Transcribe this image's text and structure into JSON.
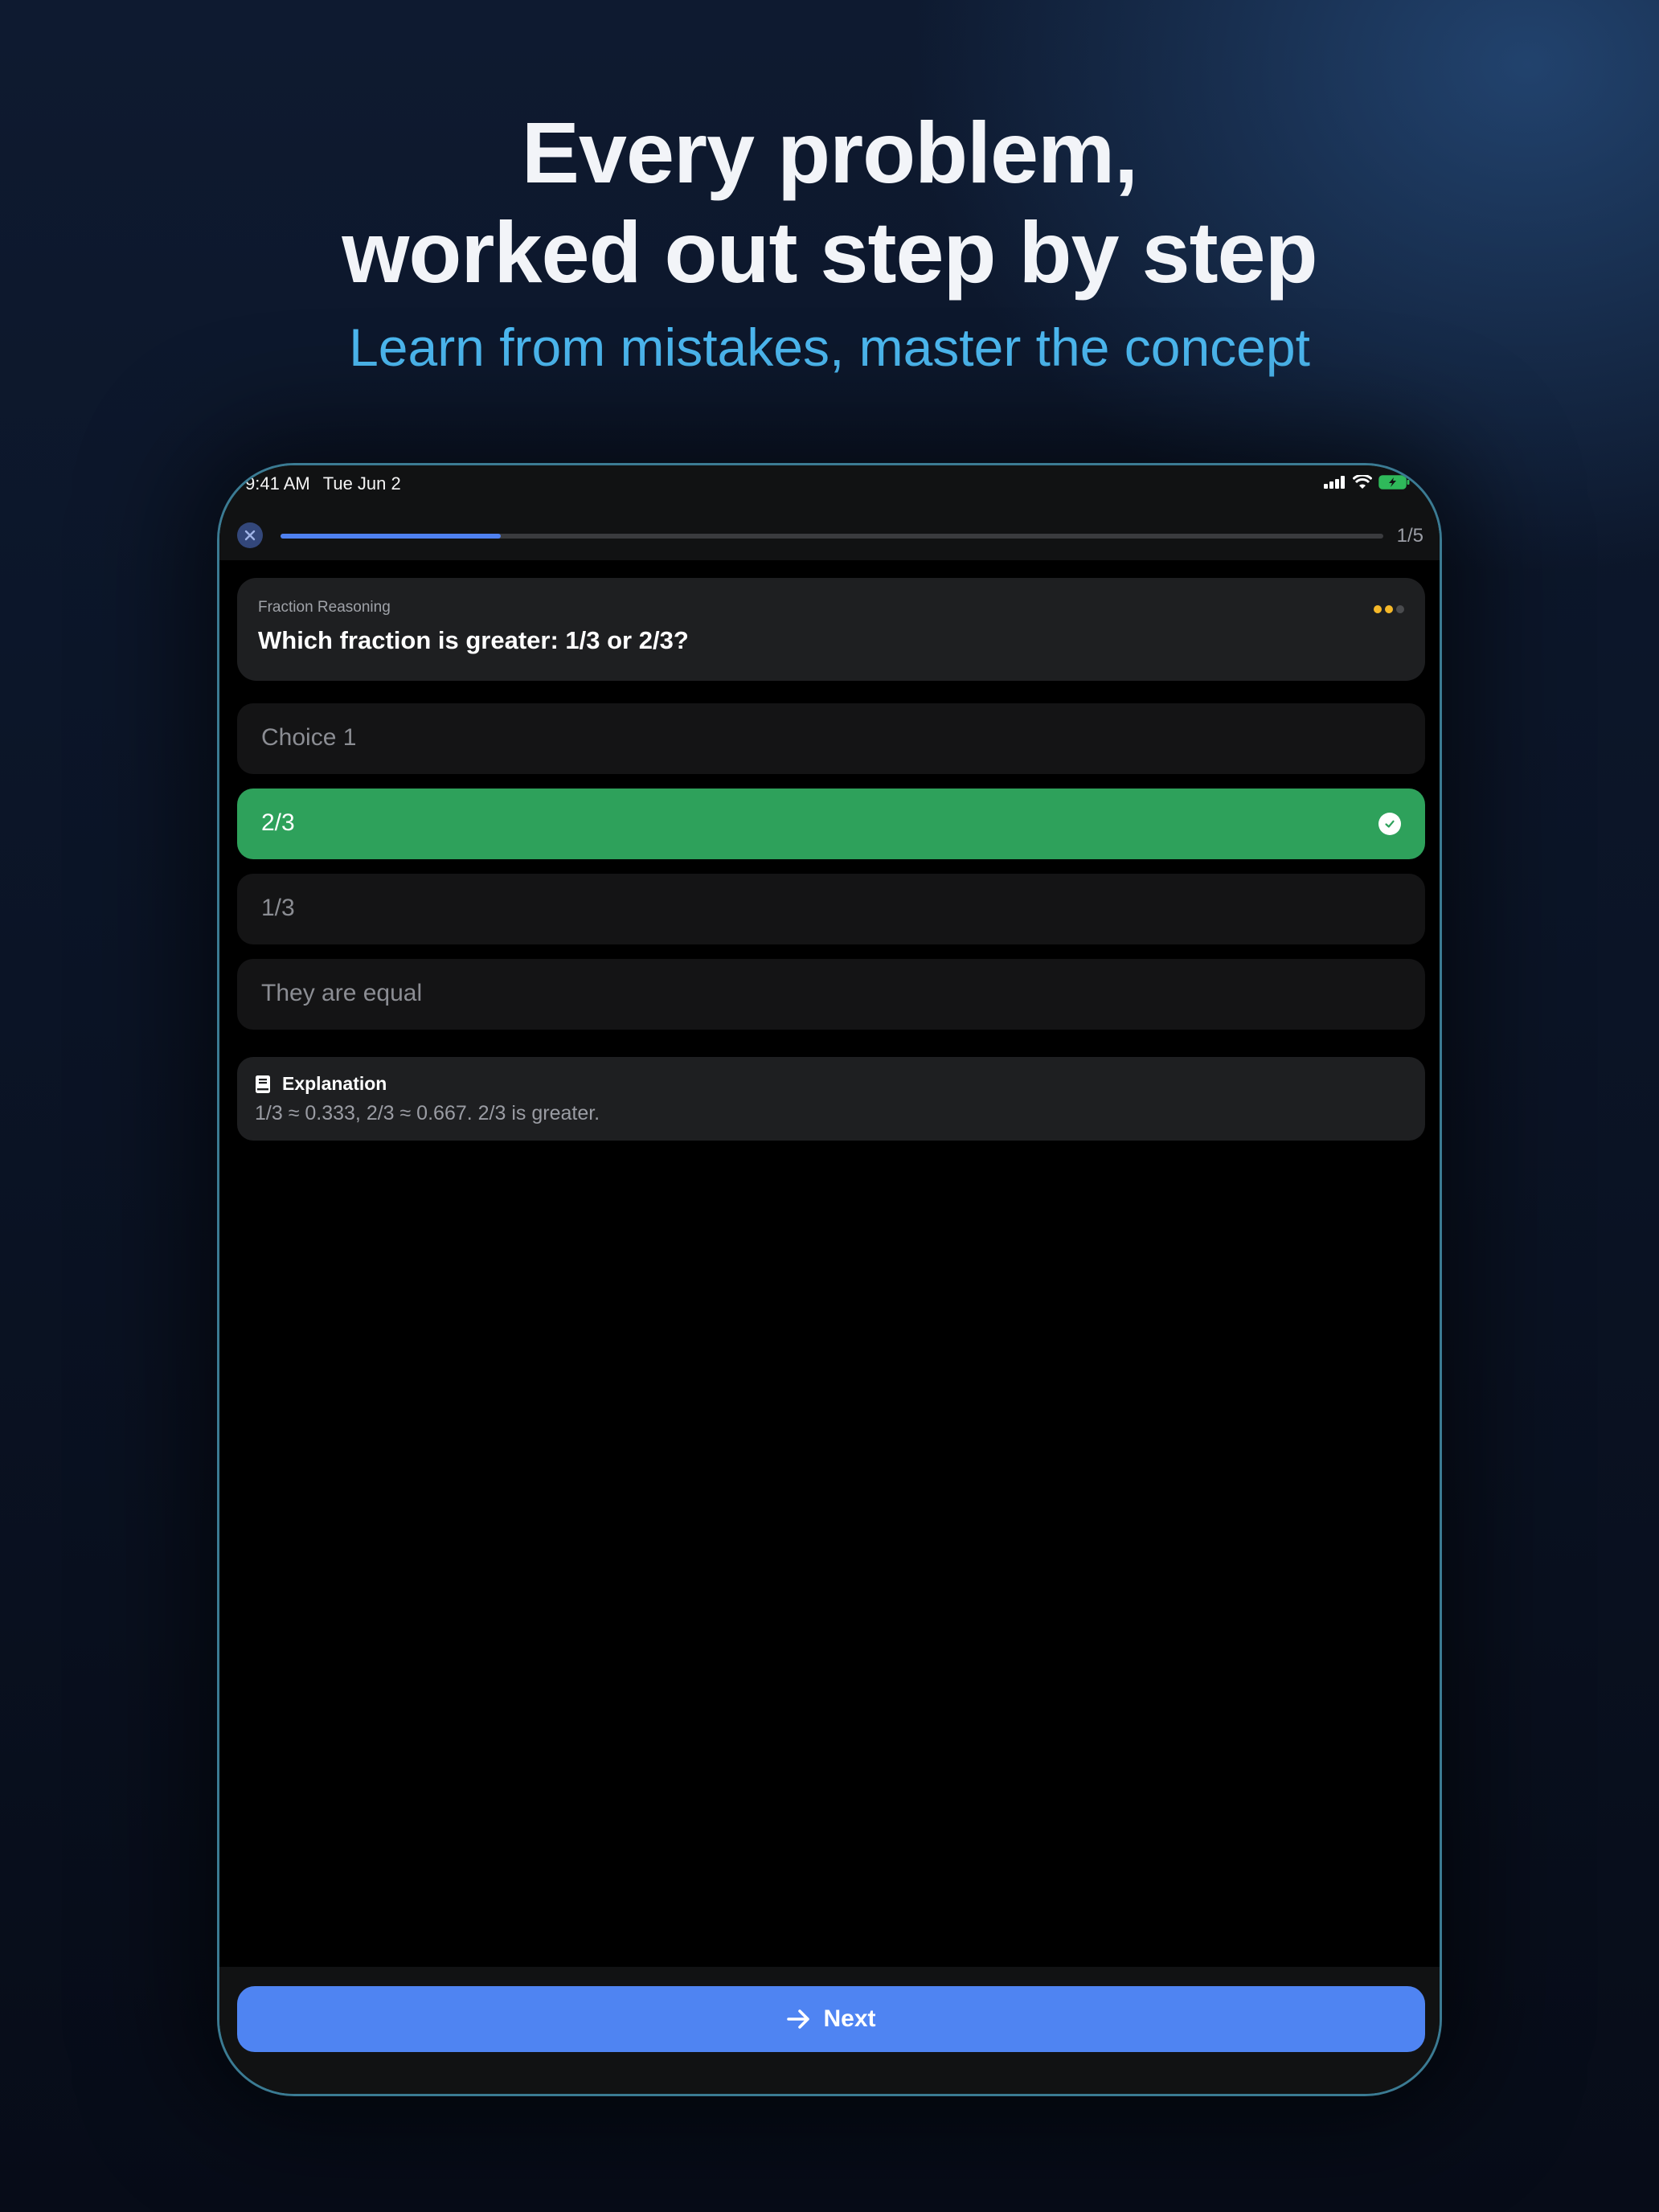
{
  "hero": {
    "title_line1": "Every problem,",
    "title_line2": "worked out step by step",
    "subtitle": "Learn from mistakes, master the concept"
  },
  "status_bar": {
    "time": "9:41 AM",
    "date": "Tue Jun 2",
    "icons": [
      "cellular-signal-icon",
      "wifi-icon",
      "battery-charging-icon"
    ]
  },
  "quiz": {
    "close_icon": "close-icon",
    "progress_fraction": 0.2,
    "progress_label": "1/5",
    "question": {
      "category": "Fraction Reasoning",
      "text": "Which fraction is greater: 1/3 or 2/3?",
      "difficulty_level": 2,
      "difficulty_max": 3
    },
    "choices": [
      {
        "label": "Choice 1",
        "state": "default"
      },
      {
        "label": "2/3",
        "state": "correct"
      },
      {
        "label": "1/3",
        "state": "default"
      },
      {
        "label": "They are equal",
        "state": "default"
      }
    ],
    "explanation": {
      "icon": "book-icon",
      "title": "Explanation",
      "text": "1/3 ≈ 0.333, 2/3 ≈ 0.667. 2/3 is greater."
    },
    "next_button": {
      "icon": "arrow-right-icon",
      "label": "Next"
    }
  },
  "colors": {
    "accent_blue": "#4f84f2",
    "correct_green": "#2ea15b",
    "subtitle_cyan": "#4cb8f0",
    "difficulty_on": "#f5b829",
    "difficulty_off": "#4a4b4e"
  }
}
